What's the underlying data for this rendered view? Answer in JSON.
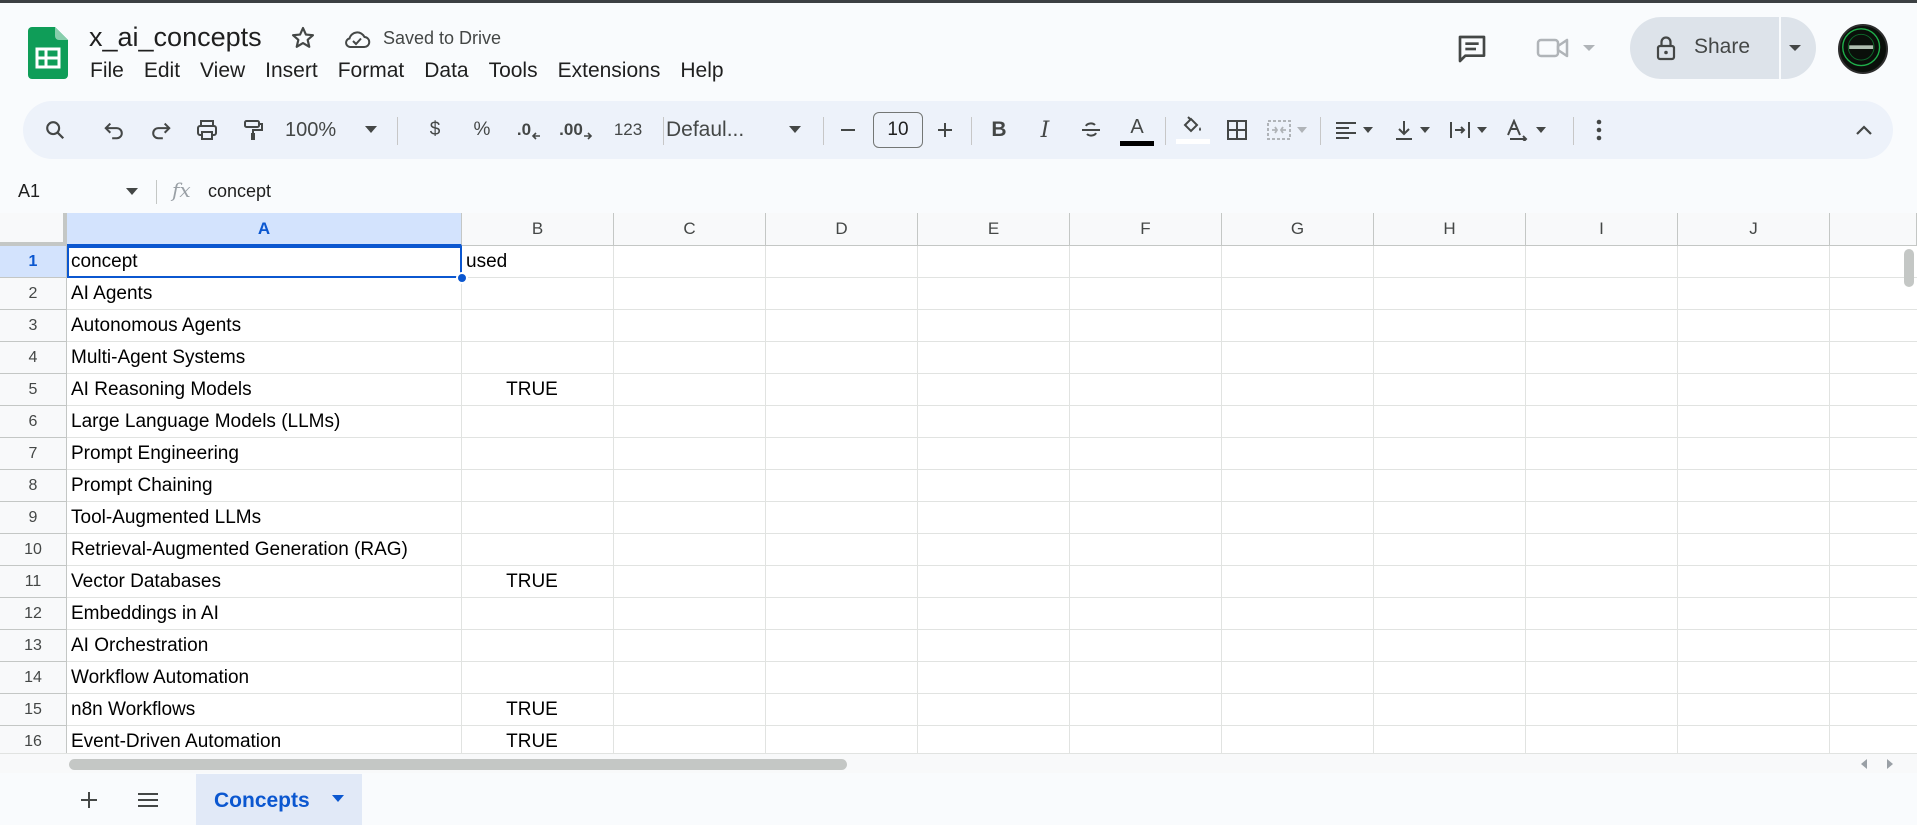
{
  "doc": {
    "title": "x_ai_concepts",
    "save_status": "Saved to Drive"
  },
  "menu": [
    "File",
    "Edit",
    "View",
    "Insert",
    "Format",
    "Data",
    "Tools",
    "Extensions",
    "Help"
  ],
  "header": {
    "share_label": "Share"
  },
  "toolbar": {
    "zoom": "100%",
    "currency": "$",
    "percent": "%",
    "decrease_decimal": ".0",
    "increase_decimal": ".00",
    "number_format": "123",
    "font": "Defaul...",
    "font_size": "10",
    "bold": "B",
    "italic": "I",
    "text_color_letter": "A"
  },
  "formula_bar": {
    "cell_ref": "A1",
    "fx": "fx",
    "content": "concept"
  },
  "columns": [
    "A",
    "B",
    "C",
    "D",
    "E",
    "F",
    "G",
    "H",
    "I",
    "J"
  ],
  "rows": [
    {
      "n": "1",
      "a": "concept",
      "b": "used"
    },
    {
      "n": "2",
      "a": "AI Agents",
      "b": ""
    },
    {
      "n": "3",
      "a": "Autonomous Agents",
      "b": ""
    },
    {
      "n": "4",
      "a": "Multi-Agent Systems",
      "b": ""
    },
    {
      "n": "5",
      "a": "AI Reasoning Models",
      "b": "TRUE"
    },
    {
      "n": "6",
      "a": "Large Language Models (LLMs)",
      "b": ""
    },
    {
      "n": "7",
      "a": "Prompt Engineering",
      "b": ""
    },
    {
      "n": "8",
      "a": "Prompt Chaining",
      "b": ""
    },
    {
      "n": "9",
      "a": "Tool-Augmented LLMs",
      "b": ""
    },
    {
      "n": "10",
      "a": "Retrieval-Augmented Generation (RAG)",
      "b": ""
    },
    {
      "n": "11",
      "a": "Vector Databases",
      "b": "TRUE"
    },
    {
      "n": "12",
      "a": "Embeddings in AI",
      "b": ""
    },
    {
      "n": "13",
      "a": "AI Orchestration",
      "b": ""
    },
    {
      "n": "14",
      "a": "Workflow Automation",
      "b": ""
    },
    {
      "n": "15",
      "a": "n8n Workflows",
      "b": "TRUE"
    },
    {
      "n": "16",
      "a": "Event-Driven Automation",
      "b": "TRUE"
    }
  ],
  "sheets": [
    {
      "label": "Concepts"
    }
  ],
  "colors": {
    "accent": "#0b57d0",
    "sheets_green": "#0f9d58",
    "selected_header": "#d3e3fd"
  }
}
